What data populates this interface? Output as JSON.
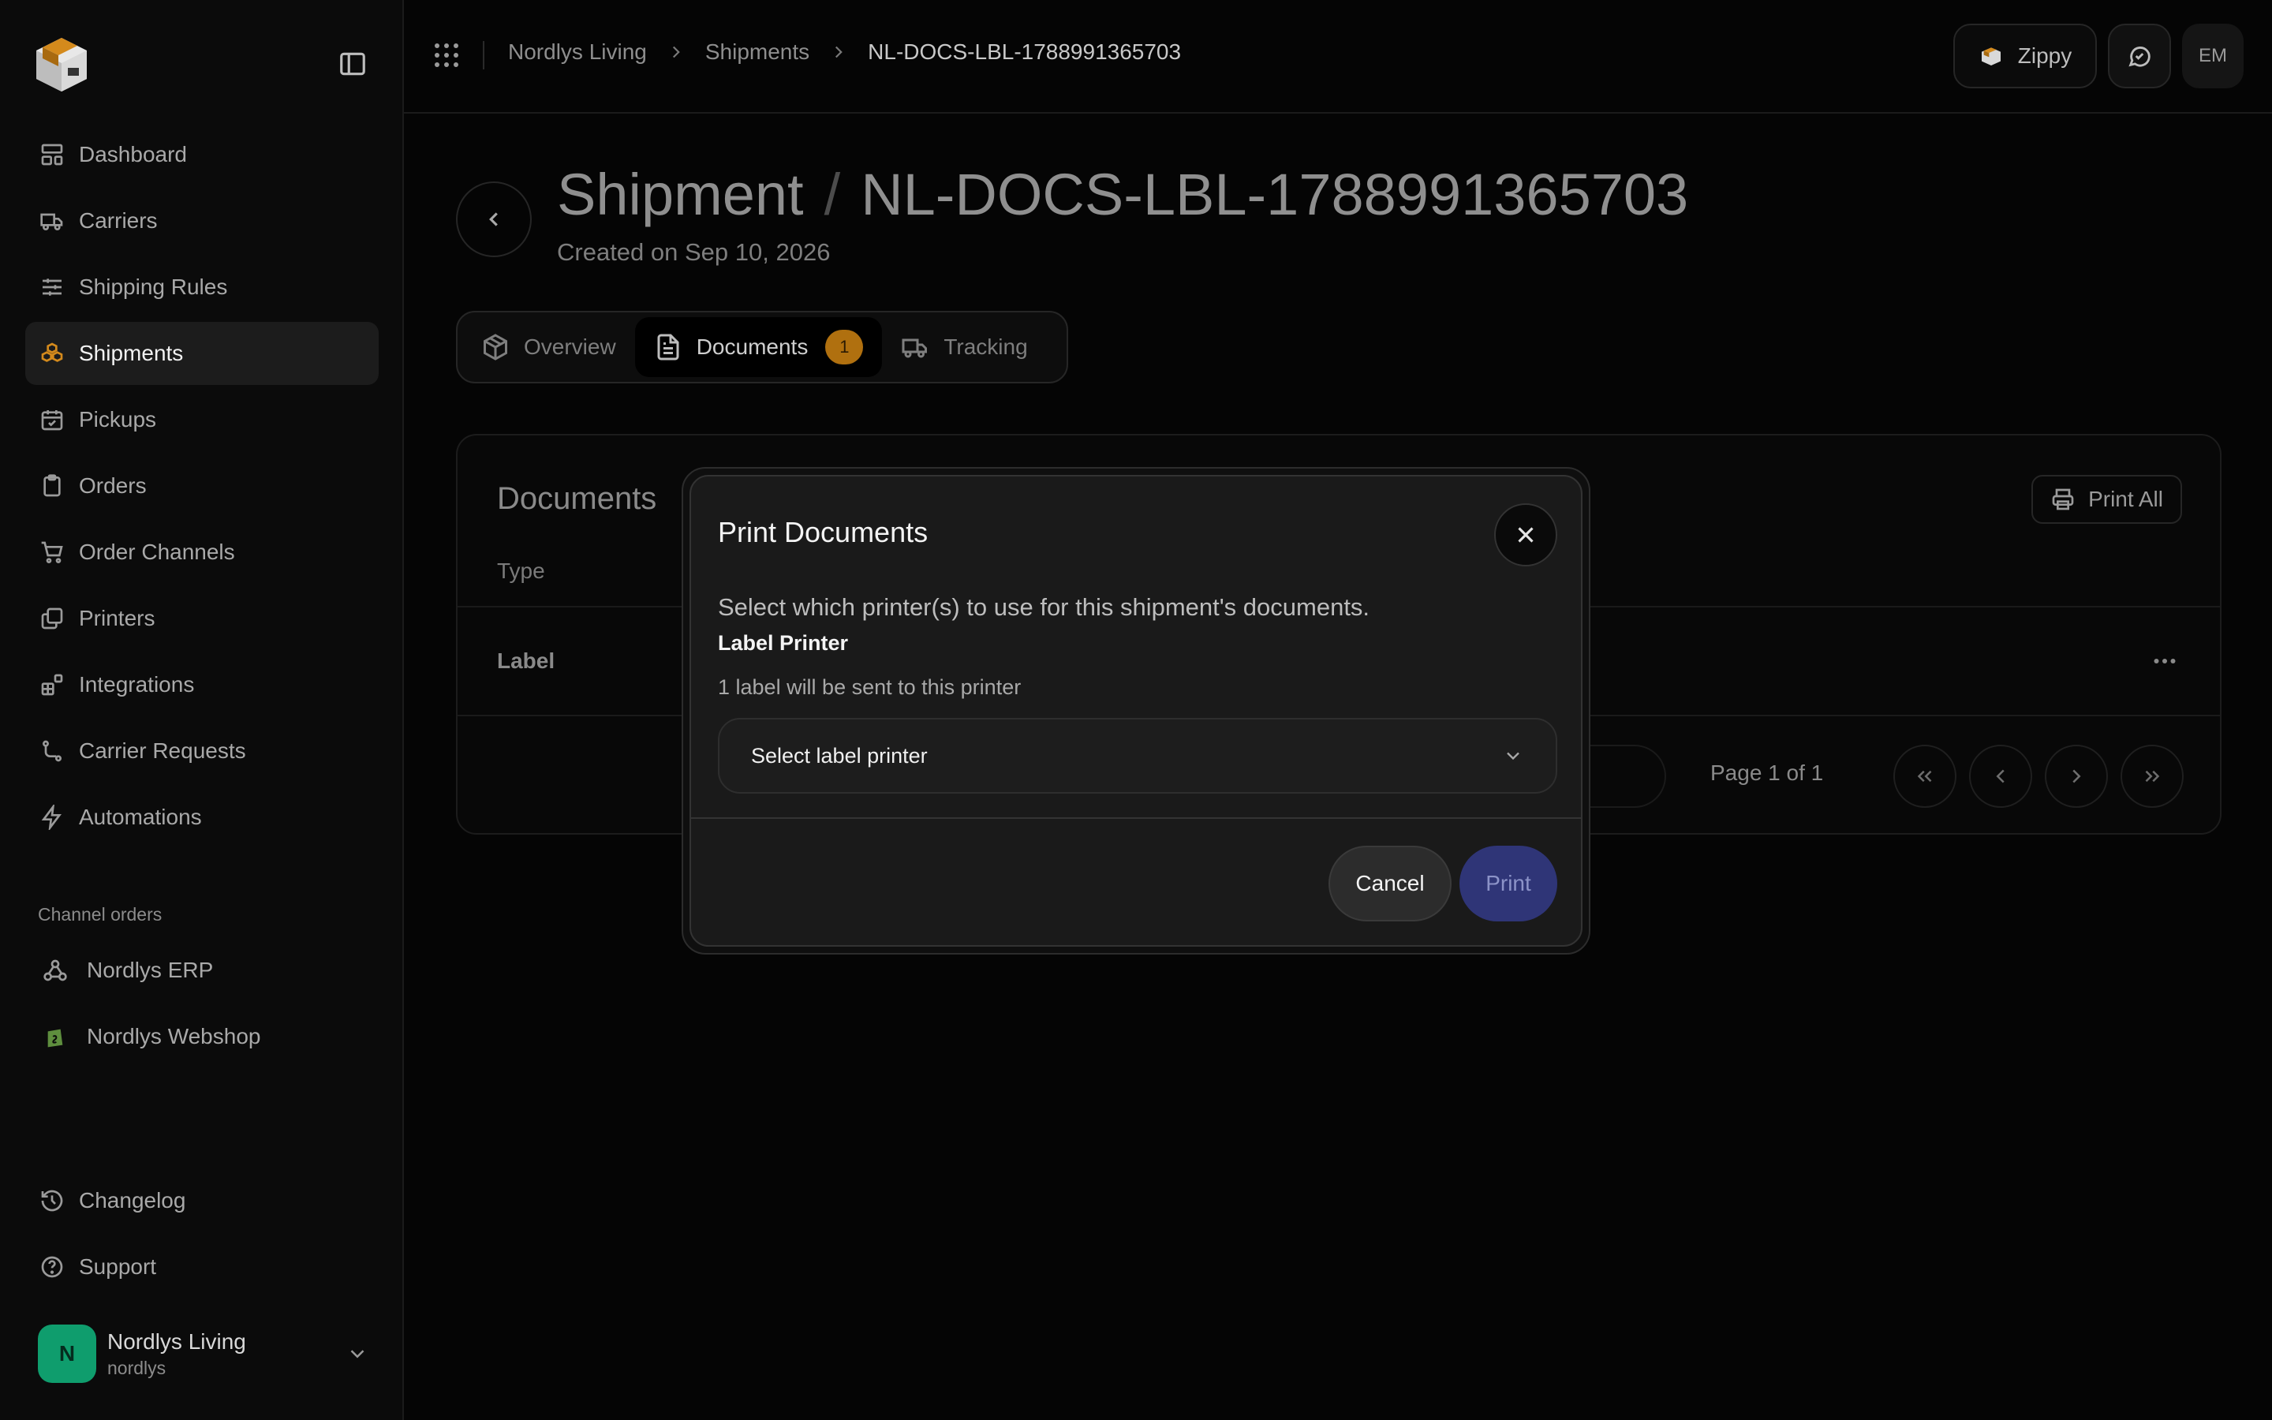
{
  "sidebar": {
    "nav": [
      {
        "label": "Dashboard",
        "icon": "dashboard-icon"
      },
      {
        "label": "Carriers",
        "icon": "truck-icon"
      },
      {
        "label": "Shipping Rules",
        "icon": "sliders-icon"
      },
      {
        "label": "Shipments",
        "icon": "boxes-icon",
        "active": true
      },
      {
        "label": "Pickups",
        "icon": "calendar-check-icon"
      },
      {
        "label": "Orders",
        "icon": "clipboard-icon"
      },
      {
        "label": "Order Channels",
        "icon": "cart-icon"
      },
      {
        "label": "Printers",
        "icon": "copy-icon"
      },
      {
        "label": "Integrations",
        "icon": "blocks-icon"
      },
      {
        "label": "Carrier Requests",
        "icon": "route-icon"
      },
      {
        "label": "Automations",
        "icon": "bolt-icon"
      }
    ],
    "channel_section_title": "Channel orders",
    "channels": [
      {
        "label": "Nordlys ERP",
        "icon": "webhook-icon"
      },
      {
        "label": "Nordlys Webshop",
        "icon": "shopify-icon"
      }
    ],
    "bottom": [
      {
        "label": "Changelog",
        "icon": "history-icon"
      },
      {
        "label": "Support",
        "icon": "help-circle-icon"
      }
    ],
    "user": {
      "initial": "N",
      "name": "Nordlys Living",
      "handle": "nordlys"
    }
  },
  "topbar": {
    "breadcrumb": [
      "Nordlys Living",
      "Shipments",
      "NL-DOCS-LBL-1788991365703"
    ],
    "assistant_label": "Zippy",
    "user_initials": "EM"
  },
  "page": {
    "title_prefix": "Shipment",
    "title_separator": "/",
    "title_id": "NL-DOCS-LBL-1788991365703",
    "subtitle": "Created on Sep 10, 2026"
  },
  "tabs": [
    {
      "label": "Overview",
      "icon": "package-icon"
    },
    {
      "label": "Documents",
      "icon": "file-text-icon",
      "badge": "1",
      "active": true
    },
    {
      "label": "Tracking",
      "icon": "truck-icon"
    }
  ],
  "documents": {
    "title": "Documents",
    "print_all_label": "Print All",
    "column_type": "Type",
    "rows": [
      {
        "type": "Label"
      }
    ],
    "pagination": "Page 1 of 1"
  },
  "modal": {
    "title": "Print Documents",
    "description": "Select which printer(s) to use for this shipment's documents.",
    "printer_label": "Label Printer",
    "printer_hint": "1 label will be sent to this printer",
    "select_placeholder": "Select label printer",
    "cancel_label": "Cancel",
    "print_label": "Print"
  },
  "colors": {
    "accent": "#d48a1c",
    "badge": "#b0700f",
    "primary_button": "#2f3577",
    "avatar": "#0f9d6d"
  }
}
